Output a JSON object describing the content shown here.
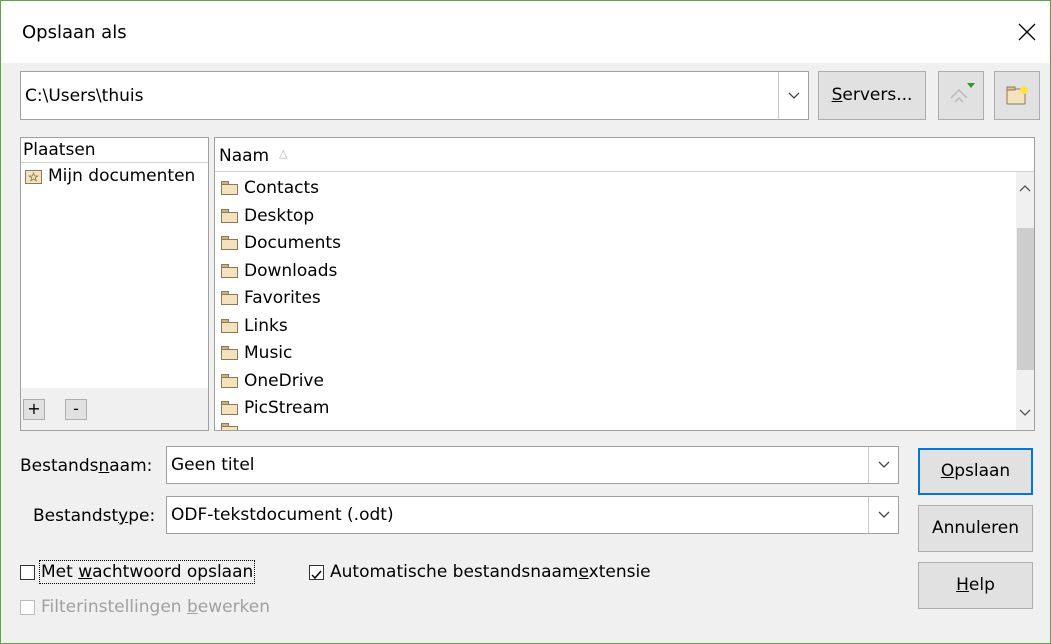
{
  "window": {
    "title": "Opslaan als"
  },
  "path": {
    "value": "C:\\Users\\thuis"
  },
  "toolbar": {
    "servers_prefix": "",
    "servers_mnemonic": "S",
    "servers_rest": "ervers..."
  },
  "places": {
    "header": "Plaatsen",
    "items": [
      {
        "label": "Mijn documenten"
      }
    ],
    "add_label": "+",
    "remove_label": "-"
  },
  "files": {
    "column_header": "Naam",
    "sort_glyph": "△",
    "items": [
      {
        "name": "Contacts"
      },
      {
        "name": "Desktop"
      },
      {
        "name": "Documents"
      },
      {
        "name": "Downloads"
      },
      {
        "name": "Favorites"
      },
      {
        "name": "Links"
      },
      {
        "name": "Music"
      },
      {
        "name": "OneDrive"
      },
      {
        "name": "PicStream"
      }
    ]
  },
  "filename": {
    "label_pre": "Bestands",
    "label_mn": "n",
    "label_post": "aam:",
    "value": "Geen titel"
  },
  "filetype": {
    "label_pre": "Bestandst",
    "label_mn": "y",
    "label_post": "pe:",
    "value": "ODF-tekstdocument (.odt)"
  },
  "buttons": {
    "save_mn": "O",
    "save_rest": "pslaan",
    "cancel": "Annuleren",
    "help_mn": "H",
    "help_rest": "elp"
  },
  "options": {
    "password_pre": "Met ",
    "password_mn": "w",
    "password_post": "achtwoord opslaan",
    "password_checked": false,
    "autoext_pre": "Automatische bestandsnaam",
    "autoext_mn": "e",
    "autoext_post": "xtensie",
    "autoext_checked": true,
    "filter_pre": "Filterinstellingen ",
    "filter_mn": "b",
    "filter_post": "ewerken",
    "filter_checked": false,
    "filter_enabled": false
  },
  "colors": {
    "accent": "#0078d7",
    "window_border": "#5aa646",
    "folder": "#f3e2bd"
  }
}
